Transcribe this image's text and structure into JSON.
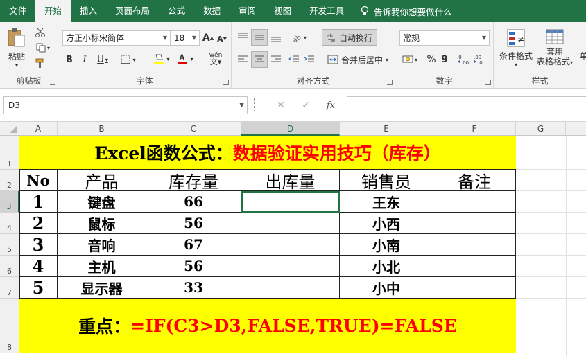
{
  "tabs": [
    "文件",
    "开始",
    "插入",
    "页面布局",
    "公式",
    "数据",
    "审阅",
    "视图",
    "开发工具"
  ],
  "active_tab": "开始",
  "tell_me": "告诉我你想要做什么",
  "ribbon": {
    "clipboard": {
      "paste": "粘贴",
      "label": "剪贴板"
    },
    "font": {
      "name": "方正小标宋简体",
      "size": "18",
      "grow": "A",
      "shrink": "A",
      "bold": "B",
      "italic": "I",
      "underline": "U",
      "label": "字体",
      "phonetic": "wén"
    },
    "alignment": {
      "wrap": "自动换行",
      "merge": "合并后居中",
      "label": "对齐方式"
    },
    "number": {
      "format": "常规",
      "percent": "%",
      "comma": "9",
      "label": "数字"
    },
    "styles": {
      "conditional": "条件格式",
      "table_line1": "套用",
      "table_line2": "表格格式",
      "label": "样式",
      "cell_partial": "单"
    }
  },
  "formula_bar": {
    "name_box": "D3",
    "cancel": "✕",
    "enter": "✓",
    "fx": "fx",
    "formula": ""
  },
  "columns": [
    "A",
    "B",
    "C",
    "D",
    "E",
    "F",
    "G"
  ],
  "rows": [
    "1",
    "2",
    "3",
    "4",
    "5",
    "6",
    "7",
    "8"
  ],
  "sheet": {
    "title_black": "Excel函数公式：",
    "title_red": "数据验证实用技巧（库存）",
    "headers": [
      "No",
      "产品",
      "库存量",
      "出库量",
      "销售员",
      "备注"
    ],
    "data": [
      [
        "1",
        "键盘",
        "66",
        "",
        "王东",
        ""
      ],
      [
        "2",
        "鼠标",
        "56",
        "",
        "小西",
        ""
      ],
      [
        "3",
        "音响",
        "67",
        "",
        "小南",
        ""
      ],
      [
        "4",
        "主机",
        "56",
        "",
        "小北",
        ""
      ],
      [
        "5",
        "显示器",
        "33",
        "",
        "小中",
        ""
      ]
    ],
    "key_black": "重点：",
    "key_red": "=IF(C3>D3,FALSE,TRUE)=FALSE"
  },
  "colors": {
    "accent": "#217346",
    "title_bg": "#ffff00",
    "title_red": "#ff0000"
  }
}
